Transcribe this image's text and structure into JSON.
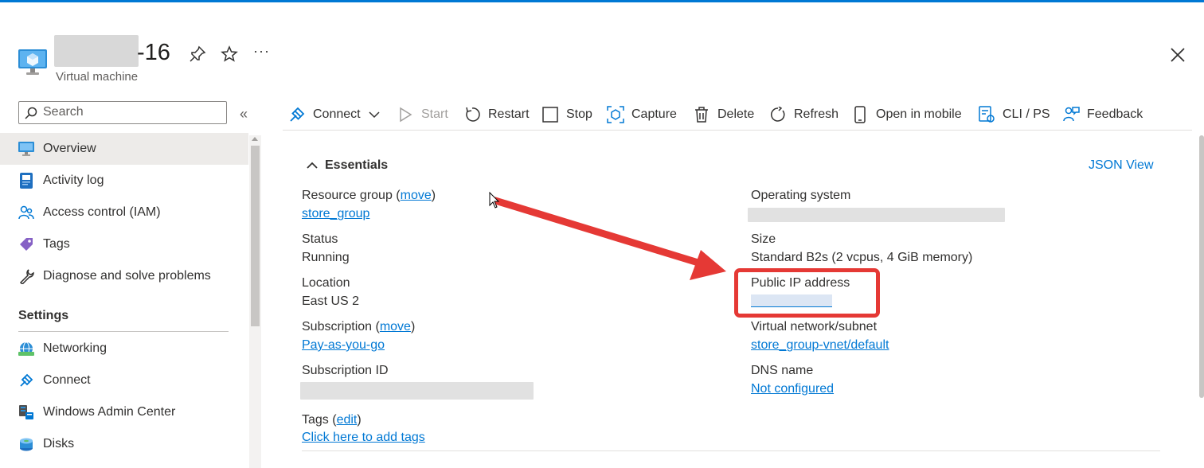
{
  "header": {
    "title_suffix": "-16",
    "subtitle": "Virtual machine",
    "pin_icon": "pin-icon",
    "favorite_icon": "star-icon",
    "more_icon": "more-icon",
    "more_glyph": "···",
    "close_icon": "close-icon"
  },
  "sidebar": {
    "search_placeholder": "Search",
    "collapse_glyph": "«",
    "items": [
      {
        "label": "Overview",
        "icon": "monitor-icon",
        "selected": true
      },
      {
        "label": "Activity log",
        "icon": "log-icon"
      },
      {
        "label": "Access control (IAM)",
        "icon": "people-icon"
      },
      {
        "label": "Tags",
        "icon": "tag-icon"
      },
      {
        "label": "Diagnose and solve problems",
        "icon": "wrench-icon"
      }
    ],
    "settings_header": "Settings",
    "settings_items": [
      {
        "label": "Networking",
        "icon": "globe-icon"
      },
      {
        "label": "Connect",
        "icon": "connect-icon"
      },
      {
        "label": "Windows Admin Center",
        "icon": "admin-center-icon"
      },
      {
        "label": "Disks",
        "icon": "disk-icon"
      }
    ]
  },
  "toolbar": {
    "connect": "Connect",
    "start": "Start",
    "restart": "Restart",
    "stop": "Stop",
    "capture": "Capture",
    "delete": "Delete",
    "refresh": "Refresh",
    "open_in_mobile": "Open in mobile",
    "cli_ps": "CLI / PS",
    "feedback": "Feedback"
  },
  "essentials": {
    "header": "Essentials",
    "json_view": "JSON View",
    "resource_group_label": "Resource group",
    "move_link": "move",
    "resource_group_value": "store_group",
    "status_label": "Status",
    "status_value": "Running",
    "location_label": "Location",
    "location_value": "East US 2",
    "subscription_label": "Subscription",
    "subscription_value": "Pay-as-you-go",
    "subscription_id_label": "Subscription ID",
    "tags_label": "Tags",
    "edit_link": "edit",
    "tags_value": "Click here to add tags",
    "os_label": "Operating system",
    "size_label": "Size",
    "size_value": "Standard B2s (2 vcpus, 4 GiB memory)",
    "public_ip_label": "Public IP address",
    "vnet_label": "Virtual network/subnet",
    "vnet_value": "store_group-vnet/default",
    "dns_label": "DNS name",
    "dns_value": "Not configured"
  },
  "colors": {
    "accent": "#0078d4",
    "annotation": "#e53935"
  }
}
